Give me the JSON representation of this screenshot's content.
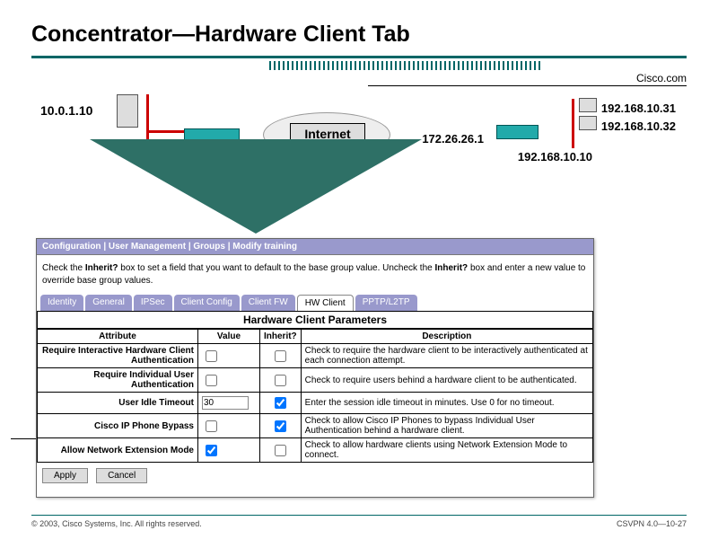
{
  "slide": {
    "title": "Concentrator—Hardware Client Tab",
    "cisco": "Cisco.com",
    "footer_left": "© 2003, Cisco Systems, Inc. All rights reserved.",
    "footer_right": "CSVPN 4.0—10-27"
  },
  "network": {
    "ip_left": "10.0.1.10",
    "ip_r1": "192.168.10.31",
    "ip_r2": "192.168.10.32",
    "ip_r3": "192.168.10.10",
    "ip_mid": "172.26.26.1",
    "internet": "Internet"
  },
  "panel": {
    "breadcrumb": "Configuration | User Management | Groups | Modify training",
    "instructions_1": "Check the ",
    "instructions_b1": "Inherit?",
    "instructions_2": " box to set a field that you want to default to the base group value. Uncheck the ",
    "instructions_b2": "Inherit?",
    "instructions_3": " box and enter a new value to override base group values.",
    "tabs": [
      "Identity",
      "General",
      "IPSec",
      "Client Config",
      "Client FW",
      "HW Client",
      "PPTP/L2TP"
    ],
    "active_tab": "HW Client",
    "table_title": "Hardware Client Parameters",
    "headers": {
      "attr": "Attribute",
      "val": "Value",
      "inh": "Inherit?",
      "desc": "Description"
    },
    "rows": [
      {
        "attr": "Require Interactive Hardware Client Authentication",
        "val_type": "check",
        "val": false,
        "inh": false,
        "desc": "Check to require the hardware client to be interactively authenticated at each connection attempt."
      },
      {
        "attr": "Require Individual User Authentication",
        "val_type": "check",
        "val": false,
        "inh": false,
        "desc": "Check to require users behind a hardware client to be authenticated."
      },
      {
        "attr": "User Idle Timeout",
        "val_type": "text",
        "val": "30",
        "inh": true,
        "desc": "Enter the session idle timeout in minutes. Use 0 for no timeout."
      },
      {
        "attr": "Cisco IP Phone Bypass",
        "val_type": "check",
        "val": false,
        "inh": true,
        "desc": "Check to allow Cisco IP Phones to bypass Individual User Authentication behind a hardware client."
      },
      {
        "attr": "Allow Network Extension Mode",
        "val_type": "check",
        "val": true,
        "inh": false,
        "desc": "Check to allow hardware clients using Network Extension Mode to connect."
      }
    ],
    "buttons": {
      "apply": "Apply",
      "cancel": "Cancel"
    }
  }
}
